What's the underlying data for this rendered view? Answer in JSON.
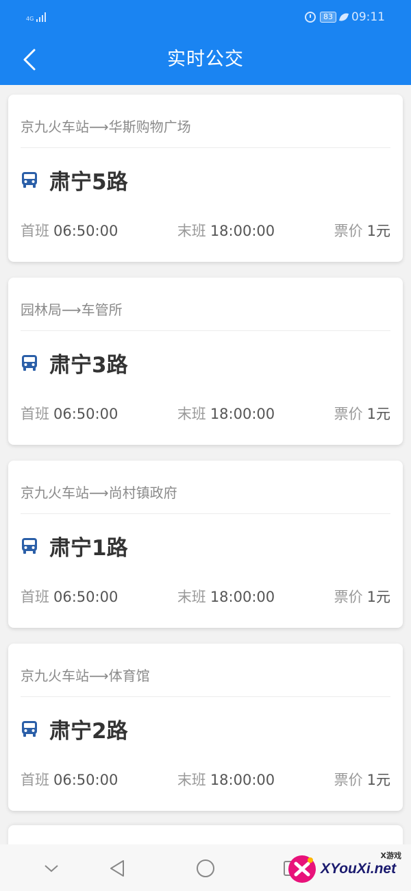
{
  "status_bar": {
    "network": "4G",
    "battery": "83",
    "time": "09:11",
    "icons": [
      "signal-icon",
      "alarm-icon",
      "battery-icon",
      "power-saving-leaf-icon"
    ]
  },
  "app_bar": {
    "title": "实时公交",
    "back_icon": "chevron-left-icon",
    "background": "#1a84f2"
  },
  "routes": [
    {
      "direction": "京九火车站⟶华斯购物广场",
      "name": "肃宁5路",
      "first_label": "首班",
      "first_time": "06:50:00",
      "last_label": "末班",
      "last_time": "18:00:00",
      "fare_label": "票价",
      "fare": "1元"
    },
    {
      "direction": "园林局⟶车管所",
      "name": "肃宁3路",
      "first_label": "首班",
      "first_time": "06:50:00",
      "last_label": "末班",
      "last_time": "18:00:00",
      "fare_label": "票价",
      "fare": "1元"
    },
    {
      "direction": "京九火车站⟶尚村镇政府",
      "name": "肃宁1路",
      "first_label": "首班",
      "first_time": "06:50:00",
      "last_label": "末班",
      "last_time": "18:00:00",
      "fare_label": "票价",
      "fare": "1元"
    },
    {
      "direction": "京九火车站⟶体育馆",
      "name": "肃宁2路",
      "first_label": "首班",
      "first_time": "06:50:00",
      "last_label": "末班",
      "last_time": "18:00:00",
      "fare_label": "票价",
      "fare": "1元"
    }
  ],
  "route_icon": "bus-icon",
  "accent_color": "#2b5fa8",
  "nav_bar": {
    "buttons": [
      "hide-keyboard-chevron-icon",
      "back-triangle-icon",
      "home-circle-icon",
      "recents-square-icon"
    ]
  },
  "watermark": {
    "brand": "XYouXi.net",
    "small": "X游戏"
  }
}
